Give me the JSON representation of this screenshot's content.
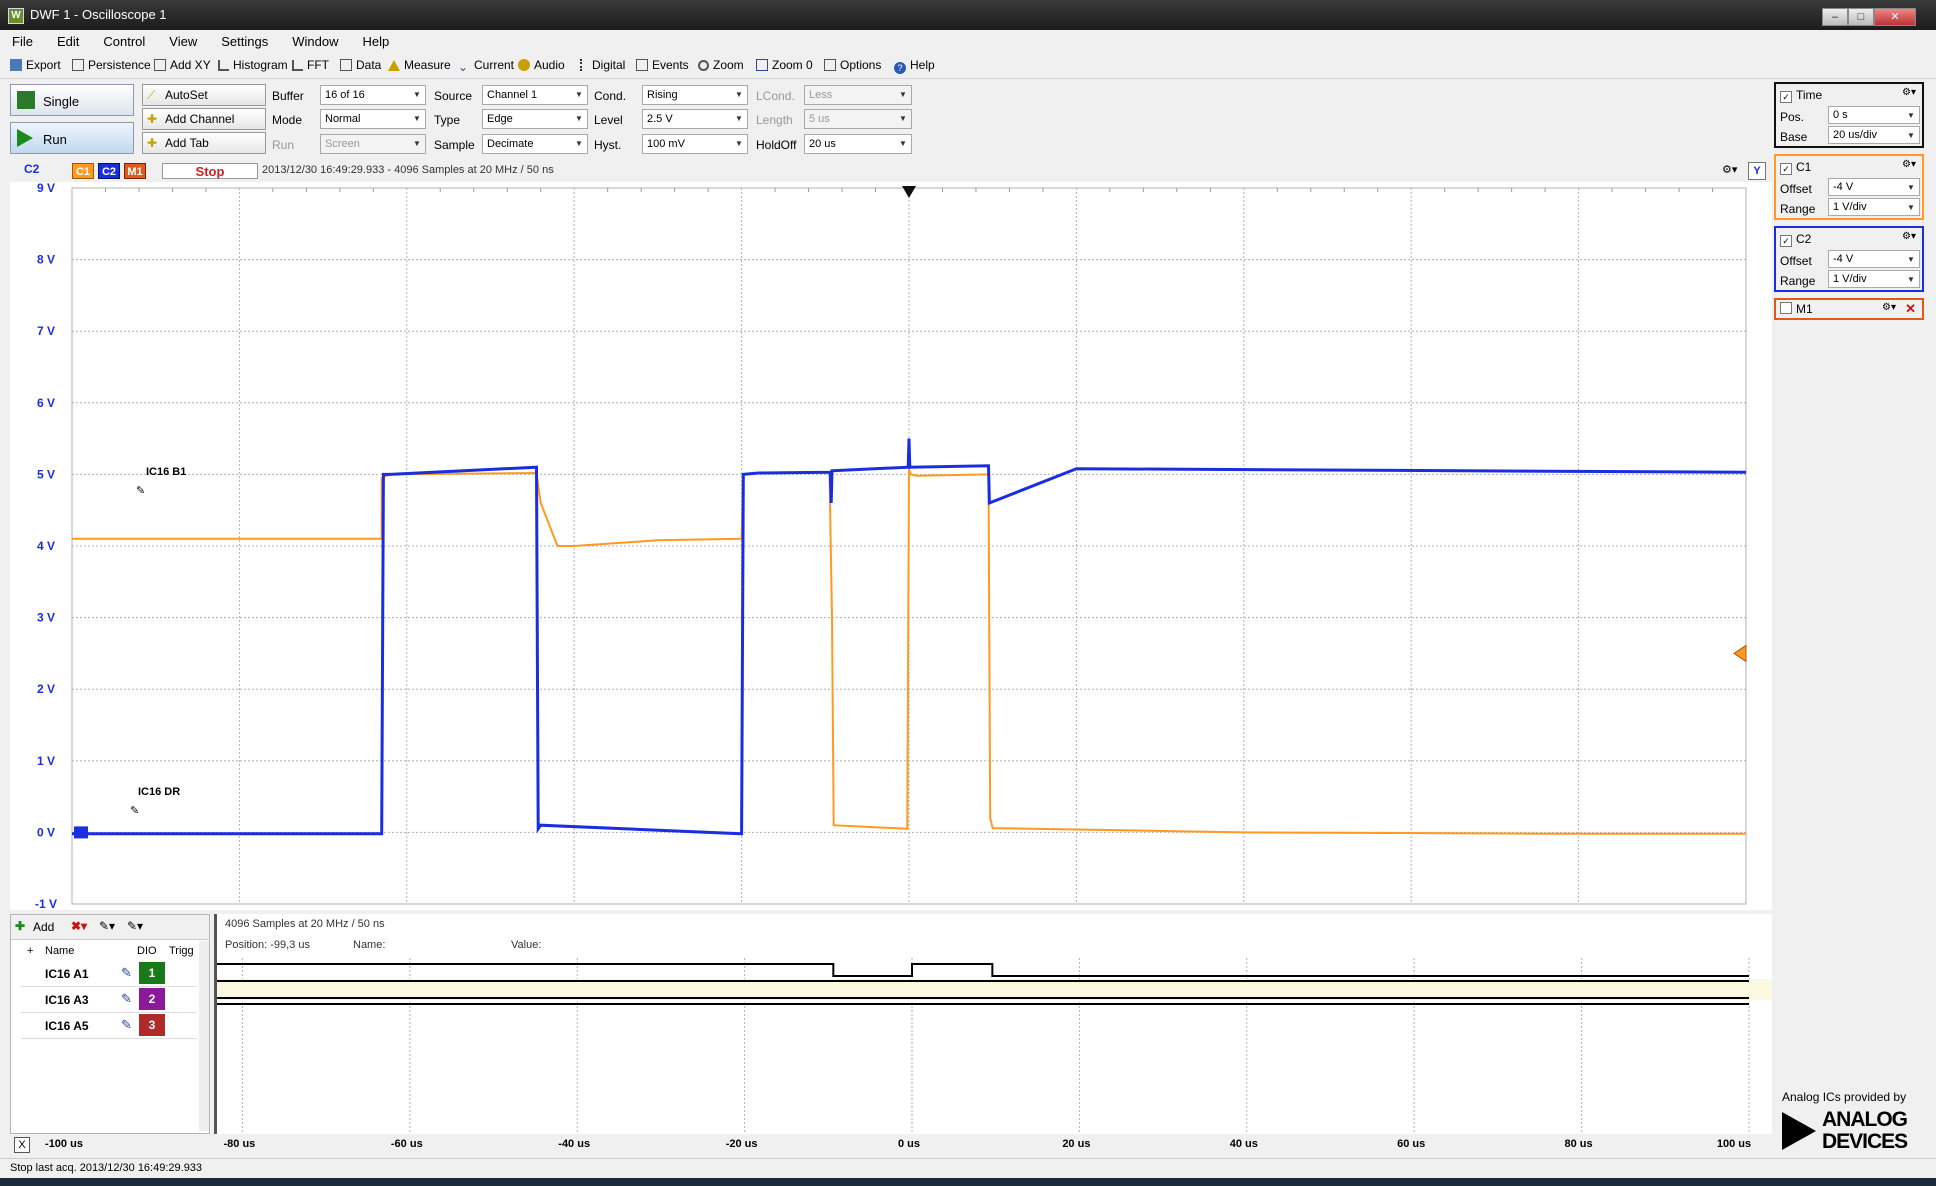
{
  "window": {
    "title": "DWF 1 - Oscilloscope 1",
    "app_icon": "W"
  },
  "menu": [
    "File",
    "Edit",
    "Control",
    "View",
    "Settings",
    "Window",
    "Help"
  ],
  "toolbar": [
    {
      "label": "Export",
      "icon": "export-icon"
    },
    {
      "label": "Persistence",
      "icon": "persistence-icon"
    },
    {
      "label": "Add XY",
      "icon": "add-xy-icon"
    },
    {
      "label": "Histogram",
      "icon": "histogram-icon"
    },
    {
      "label": "FFT",
      "icon": "fft-icon"
    },
    {
      "label": "Data",
      "icon": "data-icon"
    },
    {
      "label": "Measure",
      "icon": "measure-icon"
    },
    {
      "label": "Current",
      "icon": "current-icon"
    },
    {
      "label": "Audio",
      "icon": "audio-icon"
    },
    {
      "label": "Digital",
      "icon": "digital-icon"
    },
    {
      "label": "Events",
      "icon": "events-icon"
    },
    {
      "label": "Zoom",
      "icon": "zoom-icon"
    },
    {
      "label": "Zoom 0",
      "icon": "zoom-0-icon"
    },
    {
      "label": "Options",
      "icon": "options-icon"
    },
    {
      "label": "Help",
      "icon": "help-icon"
    }
  ],
  "control": {
    "single": "Single",
    "run": "Run",
    "autoset": "AutoSet",
    "add_channel": "Add Channel",
    "add_tab": "Add Tab",
    "buffer_label": "Buffer",
    "buffer_value": "16 of 16",
    "mode_label": "Mode",
    "mode_value": "Normal",
    "run_label": "Run",
    "run_value": "Screen",
    "source_label": "Source",
    "source_value": "Channel 1",
    "type_label": "Type",
    "type_value": "Edge",
    "sample_label": "Sample",
    "sample_value": "Decimate",
    "cond_label": "Cond.",
    "cond_value": "Rising",
    "level_label": "Level",
    "level_value": "2.5 V",
    "hyst_label": "Hyst.",
    "hyst_value": "100 mV",
    "lcond_label": "LCond.",
    "lcond_value": "Less",
    "length_label": "Length",
    "length_value": "5 us",
    "holdoff_label": "HoldOff",
    "holdoff_value": "20 us"
  },
  "scope": {
    "axis_channel": "C2",
    "c1_tag": "C1",
    "c2_tag": "C2",
    "m1_tag": "M1",
    "state": "Stop",
    "info": "2013/12/30  16:49:29.933 - 4096 Samples at 20 MHz / 50 ns",
    "y_button": "Y",
    "trace_label_1": "IC16 B1",
    "trace_label_2": "IC16 DR",
    "colors": {
      "c1": "#ff9922",
      "c2": "#1a2ee0",
      "m1": "#e05a1e",
      "grid": "#b0b0b0"
    }
  },
  "time_panel": {
    "title": "Time",
    "pos_label": "Pos.",
    "pos_value": "0 s",
    "base_label": "Base",
    "base_value": "20 us/div"
  },
  "c1_panel": {
    "title": "C1",
    "offset_label": "Offset",
    "offset_value": "-4 V",
    "range_label": "Range",
    "range_value": "1 V/div"
  },
  "c2_panel": {
    "title": "C2",
    "offset_label": "Offset",
    "offset_value": "-4 V",
    "range_label": "Range",
    "range_value": "1 V/div"
  },
  "m1_panel": {
    "title": "M1"
  },
  "logic": {
    "add_label": "Add",
    "info": "4096 Samples at 20 MHz / 50 ns",
    "position_label": "Position: -99,3 us",
    "name_label": "Name:",
    "value_label": "Value:",
    "col_plus": "+",
    "col_name": "Name",
    "col_dio": "DIO",
    "col_trig": "Trigg",
    "rows": [
      {
        "name": "IC16 A1",
        "dio": "1",
        "color": "#1a7a1a"
      },
      {
        "name": "IC16 A3",
        "dio": "2",
        "color": "#8a1a9a"
      },
      {
        "name": "IC16 A5",
        "dio": "3",
        "color": "#b02a2a"
      }
    ]
  },
  "x_axis": {
    "close_label": "X"
  },
  "status": "Stop last acq. 2013/12/30  16:49:29.933",
  "adi": {
    "caption": "Analog ICs provided by",
    "brand_line1": "ANALOG",
    "brand_line2": "DEVICES"
  },
  "chart_data": {
    "type": "line",
    "x_ticks": [
      "-100 us",
      "-80 us",
      "-60 us",
      "-40 us",
      "-20 us",
      "0 us",
      "20 us",
      "40 us",
      "60 us",
      "80 us",
      "100 us"
    ],
    "y_ticks": [
      "9 V",
      "8 V",
      "7 V",
      "6 V",
      "5 V",
      "4 V",
      "3 V",
      "2 V",
      "1 V",
      "0 V",
      "-1 V"
    ],
    "xlim": [
      -100,
      100
    ],
    "ylim": [
      -1,
      9
    ],
    "grid": true,
    "series": [
      {
        "name": "C1",
        "color": "#ff9922",
        "x": [
          -100,
          -63,
          -63,
          -62,
          -44.5,
          -44,
          -42,
          -40,
          -30,
          -20,
          -19.8,
          -18,
          -9.5,
          -9.2,
          -9,
          -0.2,
          0,
          0.2,
          1,
          9.5,
          9.7,
          10,
          20,
          40,
          80,
          100
        ],
        "y": [
          4.1,
          4.1,
          4.95,
          5.0,
          5.02,
          4.6,
          4.0,
          4.0,
          4.08,
          4.1,
          5.0,
          5.02,
          5.03,
          3.0,
          0.1,
          0.05,
          5.08,
          5.0,
          4.98,
          5.0,
          0.2,
          0.06,
          0.04,
          0.0,
          -0.02,
          -0.02
        ]
      },
      {
        "name": "C2",
        "color": "#1a2ee0",
        "x": [
          -100,
          -63,
          -62.8,
          -62,
          -44.5,
          -44.3,
          -44,
          -20,
          -19.8,
          -18,
          -9.4,
          -9.3,
          -9.2,
          -0.1,
          0,
          0.1,
          9.5,
          9.6,
          20,
          100
        ],
        "y": [
          -0.02,
          -0.02,
          5.0,
          5.0,
          5.1,
          0.05,
          0.1,
          -0.02,
          5.0,
          5.02,
          5.03,
          4.6,
          5.05,
          5.1,
          5.5,
          5.1,
          5.12,
          4.6,
          5.08,
          5.03
        ]
      }
    ]
  }
}
